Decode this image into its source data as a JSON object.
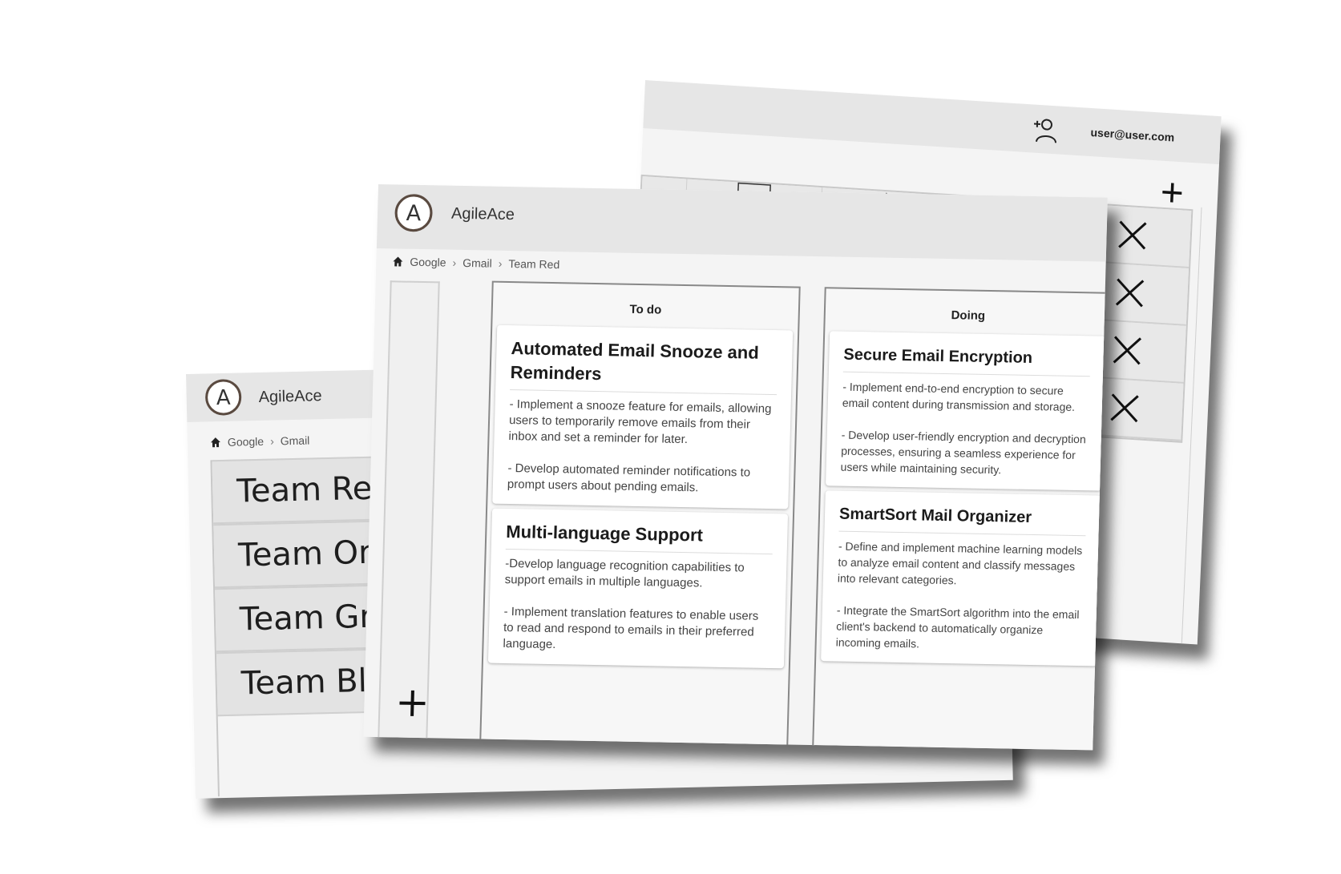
{
  "app": {
    "name": "AgileAce",
    "logo_letter": "A"
  },
  "back_screen": {
    "user_email": "user@user.com",
    "icons": {
      "add_user": "add-user-icon",
      "add": "plus-icon",
      "delete": "close-icon",
      "edit": "square-icon",
      "settings": "gear-icon",
      "export": "export-icon"
    },
    "rows": [
      {
        "id": 1
      },
      {
        "id": 2
      },
      {
        "id": 3
      },
      {
        "id": 4
      }
    ]
  },
  "left_screen": {
    "breadcrumb": [
      "Google",
      "Gmail"
    ],
    "teams": [
      "Team Red",
      "Team Orange",
      "Team Green",
      "Team Blue"
    ]
  },
  "front_screen": {
    "breadcrumb": [
      "Google",
      "Gmail",
      "Team Red"
    ],
    "columns": [
      {
        "title": "To do",
        "cards": [
          {
            "title": "Automated Email Snooze and Reminders",
            "description": "- Implement a snooze feature for emails, allowing users to temporarily remove emails from their inbox and set a reminder for later.\n\n- Develop automated reminder notifications to prompt users about pending emails."
          },
          {
            "title": "Multi-language Support",
            "description": "-Develop language recognition capabilities to support emails in multiple languages.\n\n- Implement translation features to enable users to read and respond to emails in their preferred language."
          }
        ]
      },
      {
        "title": "Doing",
        "cards": [
          {
            "title": "Secure Email Encryption",
            "description": "- Implement end-to-end encryption to secure email content during transmission and storage.\n\n- Develop user-friendly encryption and decryption processes, ensuring a seamless experience for users while maintaining security."
          },
          {
            "title": "SmartSort Mail Organizer",
            "description": "- Define and implement machine learning models to analyze email content and classify messages into relevant categories.\n\n- Integrate the SmartSort algorithm into the email client's backend to automatically organize incoming emails."
          }
        ]
      }
    ]
  }
}
